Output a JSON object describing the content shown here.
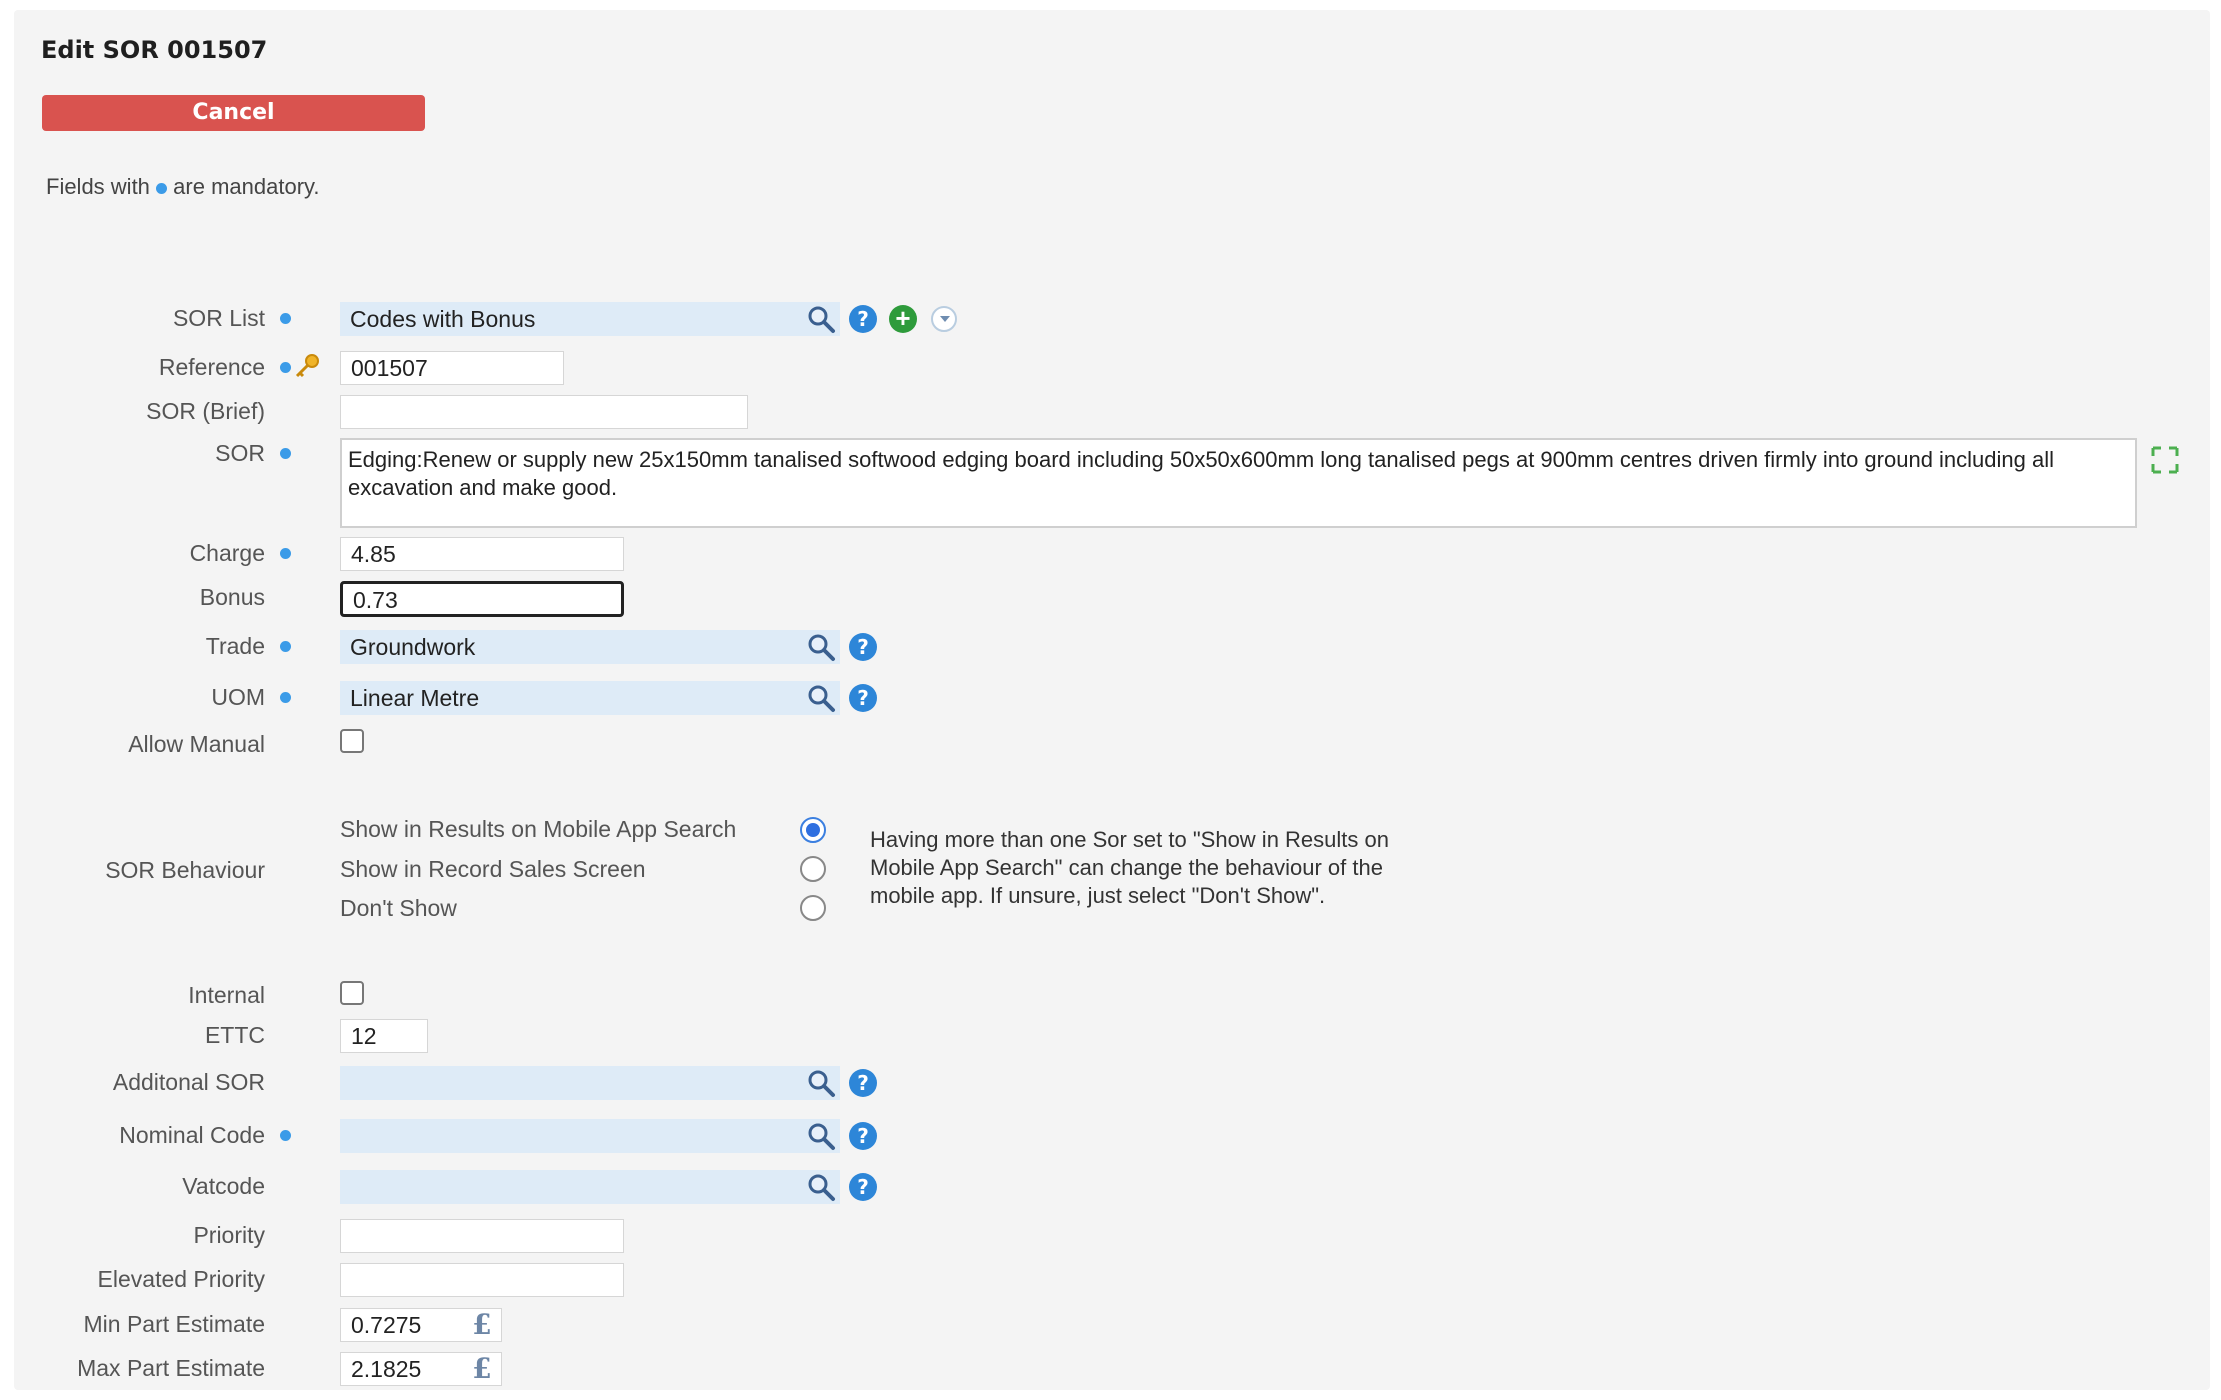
{
  "header": {
    "title": "Edit SOR 001507",
    "cancel_label": "Cancel"
  },
  "mandatory_note": {
    "prefix": "Fields with",
    "suffix": "are mandatory."
  },
  "labels": {
    "sor_list": "SOR List",
    "reference": "Reference",
    "sor_brief": "SOR (Brief)",
    "sor": "SOR",
    "charge": "Charge",
    "bonus": "Bonus",
    "trade": "Trade",
    "uom": "UOM",
    "allow_manual": "Allow Manual",
    "sor_behaviour": "SOR Behaviour",
    "internal": "Internal",
    "ettc": "ETTC",
    "additional_sor": "Additonal SOR",
    "nominal_code": "Nominal Code",
    "vatcode": "Vatcode",
    "priority": "Priority",
    "elevated_priority": "Elevated Priority",
    "min_part_estimate": "Min Part Estimate",
    "max_part_estimate": "Max Part Estimate"
  },
  "values": {
    "sor_list": "Codes with Bonus",
    "reference": "001507",
    "sor_brief": "",
    "sor": "Edging:Renew or supply new 25x150mm tanalised softwood edging board including 50x50x600mm long tanalised pegs at 900mm centres driven firmly into ground including all excavation and make good.",
    "charge": "4.85",
    "bonus": "0.73",
    "trade": "Groundwork",
    "uom": "Linear Metre",
    "allow_manual": false,
    "internal": false,
    "ettc": "12",
    "additional_sor": "",
    "nominal_code": "",
    "vatcode": "",
    "priority": "",
    "elevated_priority": "",
    "min_part_estimate": "0.7275",
    "max_part_estimate": "2.1825"
  },
  "sor_behaviour": {
    "options": [
      "Show in Results on Mobile App Search",
      "Show in Record Sales Screen",
      "Don't Show"
    ],
    "selected": "Show in Results on Mobile App Search",
    "note": "Having more than one Sor set to \"Show in Results on Mobile App Search\" can change the behaviour of the mobile app. If unsure, just select \"Don't Show\"."
  },
  "icons": {
    "search": "search-icon",
    "help": "help-icon",
    "add": "add-icon",
    "dropdown": "dropdown-icon",
    "key": "key-icon",
    "expand": "expand-icon",
    "currency": "pound-icon"
  },
  "colors": {
    "cancel": "#d9534f",
    "mandatory_dot": "#3b9be8",
    "lookup_bg": "#deebf7",
    "help": "#2d86d8",
    "add": "#2e9b3b"
  }
}
